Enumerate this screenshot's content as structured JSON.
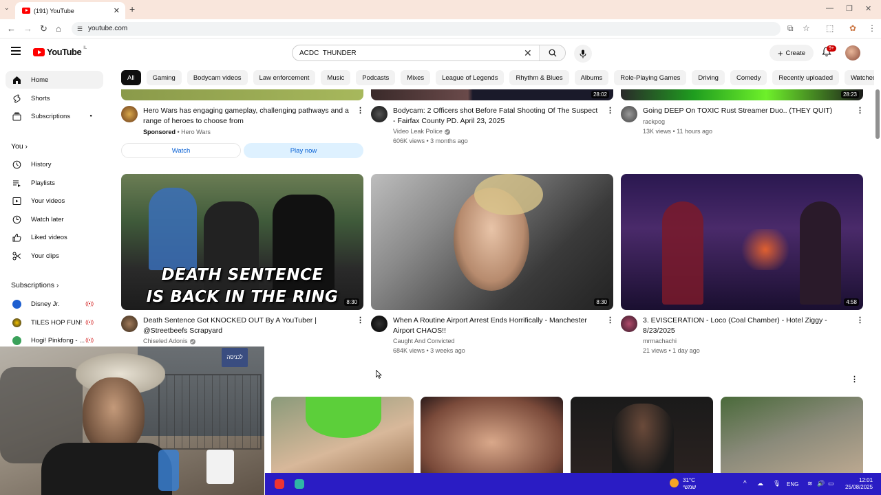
{
  "browser": {
    "tab_title": "(191) YouTube",
    "url": "youtube.com"
  },
  "header": {
    "country_code": "IL",
    "search_query": "ACDC  THUNDER",
    "create_label": "Create",
    "notifications_badge": "9+"
  },
  "chips": [
    "All",
    "Gaming",
    "Bodycam videos",
    "Law enforcement",
    "Music",
    "Podcasts",
    "Mixes",
    "League of Legends",
    "Rhythm & Blues",
    "Albums",
    "Role-Playing Games",
    "Driving",
    "Comedy",
    "Recently uploaded",
    "Watched"
  ],
  "sidebar": {
    "main": [
      {
        "label": "Home",
        "icon": "home-icon"
      },
      {
        "label": "Shorts",
        "icon": "shorts-icon"
      },
      {
        "label": "Subscriptions",
        "icon": "subscriptions-icon"
      }
    ],
    "you_heading": "You",
    "you": [
      {
        "label": "History",
        "icon": "history-icon"
      },
      {
        "label": "Playlists",
        "icon": "playlists-icon"
      },
      {
        "label": "Your videos",
        "icon": "your-videos-icon"
      },
      {
        "label": "Watch later",
        "icon": "watch-later-icon"
      },
      {
        "label": "Liked videos",
        "icon": "liked-icon"
      },
      {
        "label": "Your clips",
        "icon": "clips-icon"
      }
    ],
    "subscriptions_heading": "Subscriptions",
    "subscriptions": [
      {
        "label": "Disney Jr.",
        "color": "#1e5fd0"
      },
      {
        "label": "TILES HOP FUN!",
        "color": "#222222"
      },
      {
        "label": "Hogi! Pinkfong - ...",
        "color": "#3aa15a"
      }
    ]
  },
  "row1": [
    {
      "title_l1": "Hero Wars has engaging gameplay, challenging pathways and a",
      "title_l2": "range of heroes to choose from",
      "sponsored": "Sponsored",
      "channel": "Hero Wars",
      "btn_watch": "Watch",
      "btn_play": "Play now"
    },
    {
      "duration": "28:02",
      "title_l1": "Bodycam: 2 Officers shot Before Fatal Shooting Of The Suspect",
      "title_l2": "- Fairfax County PD. April 23, 2025",
      "channel": "Video Leak Police",
      "meta": "606K views • 3 months ago"
    },
    {
      "duration": "28:23",
      "title_l1": "Going DEEP On TOXIC Rust Streamer Duo.. (THEY QUIT)",
      "channel": "rackpog",
      "meta": "13K views • 11 hours ago"
    }
  ],
  "row2": [
    {
      "duration": "8:30",
      "overlay_l1": "DEATH SENTENCE",
      "overlay_l2": "IS BACK IN THE RING",
      "title_l1": "Death Sentence Got KNOCKED OUT By A YouTuber |",
      "title_l2": "@Streetbeefs Scrapyard",
      "channel": "Chiseled Adonis"
    },
    {
      "duration": "8:30",
      "title_l1": "When A Routine Airport Arrest Ends Horrifically - Manchester",
      "title_l2": "Airport CHAOS!!",
      "channel": "Caught And Convicted",
      "meta": "684K views • 3 weeks ago"
    },
    {
      "duration": "4:58",
      "title_l1": "3. EVISCERATION - Loco (Coal Chamber) - Hotel Ziggy -",
      "title_l2": "8/23/2025",
      "channel": "mrmachachi",
      "meta": "21 views • 1 day ago"
    }
  ],
  "webcam": {
    "sign_text": "לכניסה"
  },
  "taskbar": {
    "temperature": "31°C",
    "weather_text": "שמשי",
    "language": "ENG",
    "time": "12:01",
    "date": "25/08/2025"
  }
}
